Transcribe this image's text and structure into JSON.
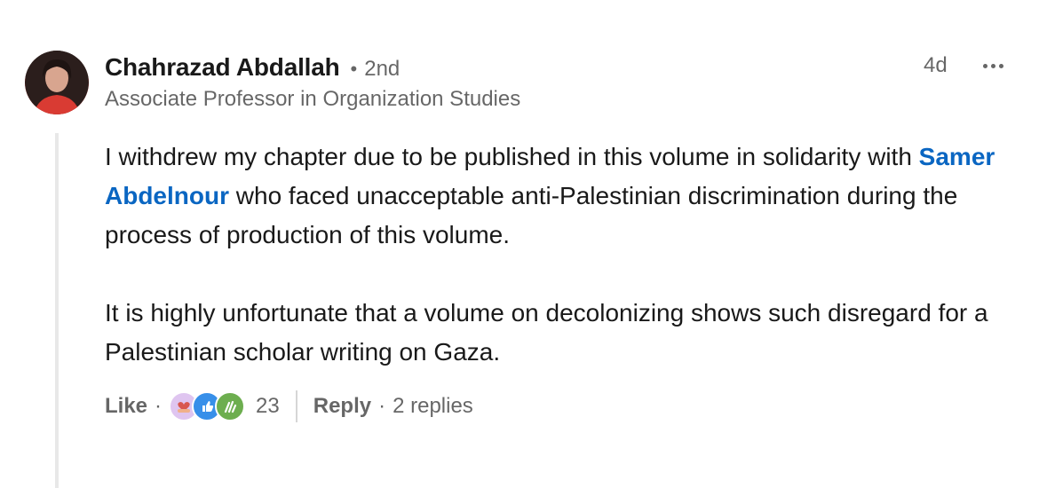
{
  "comment": {
    "author": "Chahrazad Abdallah",
    "separator": "•",
    "degree": "2nd",
    "headline": "Associate Professor in Organization Studies",
    "time": "4d",
    "body": {
      "p1_before": "I withdrew my chapter due to be published in this volume in solidarity with ",
      "mention": "Samer Abdelnour",
      "p1_after": " who faced unacceptable anti-Palestinian discrimination during the process of production of this volume.",
      "p2": "It is highly unfortunate that a volume on decolonizing shows such disregard for a Palestinian scholar writing on Gaza."
    },
    "actions": {
      "like": "Like",
      "dot": "·",
      "reaction_count": "23",
      "reply": "Reply",
      "replies": "2 replies"
    },
    "reactions": [
      "love-reaction-icon",
      "like-reaction-icon",
      "celebrate-reaction-icon"
    ]
  },
  "colors": {
    "link": "#0a66c2",
    "secondary_text": "rgba(0,0,0,0.6)"
  }
}
